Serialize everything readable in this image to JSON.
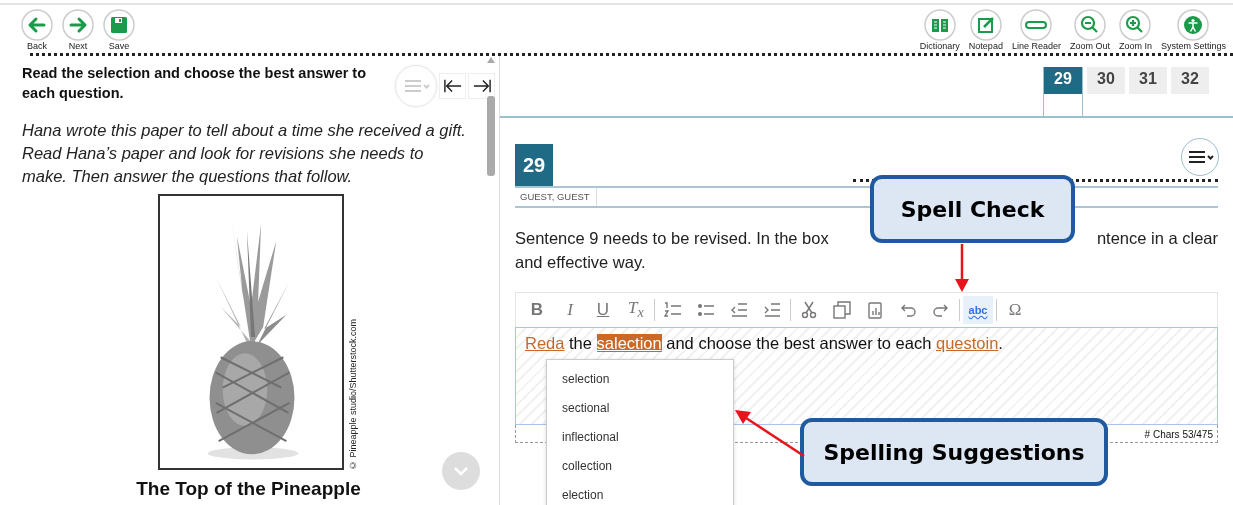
{
  "toolbar": {
    "left": [
      {
        "kind": "back",
        "label": "Back"
      },
      {
        "kind": "next",
        "label": "Next"
      },
      {
        "kind": "save",
        "label": "Save"
      }
    ],
    "right": [
      {
        "kind": "dictionary",
        "label": "Dictionary"
      },
      {
        "kind": "notepad",
        "label": "Notepad"
      },
      {
        "kind": "line-reader",
        "label": "Line Reader"
      },
      {
        "kind": "zoom-out",
        "label": "Zoom Out"
      },
      {
        "kind": "zoom-in",
        "label": "Zoom In"
      },
      {
        "kind": "settings",
        "label": "System Settings"
      }
    ]
  },
  "passage": {
    "heading": "Read the selection and choose the best answer to each question.",
    "intro": "Hana wrote this paper to tell about a time she received a gift. Read Hana’s paper and look for revisions she needs to make. Then answer the questions that follow.",
    "figure": {
      "kind": "picture",
      "credit": "© Pineapple studio/Shutterstock.com"
    },
    "title": "The Top of the Pineapple"
  },
  "tabs": [
    {
      "label": "29",
      "selected": true
    },
    {
      "label": "30",
      "selected": false
    },
    {
      "label": "31",
      "selected": false
    },
    {
      "label": "32",
      "selected": false
    }
  ],
  "question": {
    "number": "29",
    "student": "GUEST, GUEST",
    "prompt_parts": [
      "Sentence 9 needs to be revised. In the box",
      "ntence in a clear",
      "and effective way."
    ],
    "editor": {
      "tools": [
        {
          "kind": "bold",
          "glyph": "B",
          "active": false
        },
        {
          "kind": "italic",
          "glyph": "I",
          "active": false
        },
        {
          "kind": "underline",
          "glyph": "U",
          "active": false
        },
        {
          "kind": "clear-format",
          "glyph": "T$_{x}$",
          "active": false
        },
        {
          "kind": "separator"
        },
        {
          "kind": "numbered-list",
          "active": false
        },
        {
          "kind": "bulleted-list",
          "active": false
        },
        {
          "kind": "outdent",
          "active": false
        },
        {
          "kind": "indent",
          "active": false
        },
        {
          "kind": "separator"
        },
        {
          "kind": "cut",
          "active": false
        },
        {
          "kind": "copy",
          "active": false
        },
        {
          "kind": "paste",
          "active": false
        },
        {
          "kind": "undo",
          "active": false
        },
        {
          "kind": "redo",
          "active": false
        },
        {
          "kind": "separator"
        },
        {
          "kind": "spellcheck",
          "glyph": "abc",
          "active": true
        },
        {
          "kind": "separator"
        },
        {
          "kind": "special-character",
          "glyph": "Ω",
          "active": false
        }
      ],
      "text": [
        {
          "text": "Reda",
          "misspelled": true,
          "selected": false
        },
        {
          "text": " the ",
          "misspelled": false,
          "selected": false
        },
        {
          "text": "salection",
          "misspelled": true,
          "selected": true
        },
        {
          "text": " and choose the best answer to each ",
          "misspelled": false,
          "selected": false
        },
        {
          "text": "questoin",
          "misspelled": true,
          "selected": false
        },
        {
          "text": ".",
          "misspelled": false,
          "selected": false
        }
      ],
      "suggestions": [
        "selection",
        "sectional",
        "inflectional",
        "collection",
        "election"
      ],
      "counter": "# Chars 53/475"
    }
  },
  "annotations": [
    {
      "label": "Spell Check"
    },
    {
      "label": "Spelling Suggestions"
    }
  ]
}
